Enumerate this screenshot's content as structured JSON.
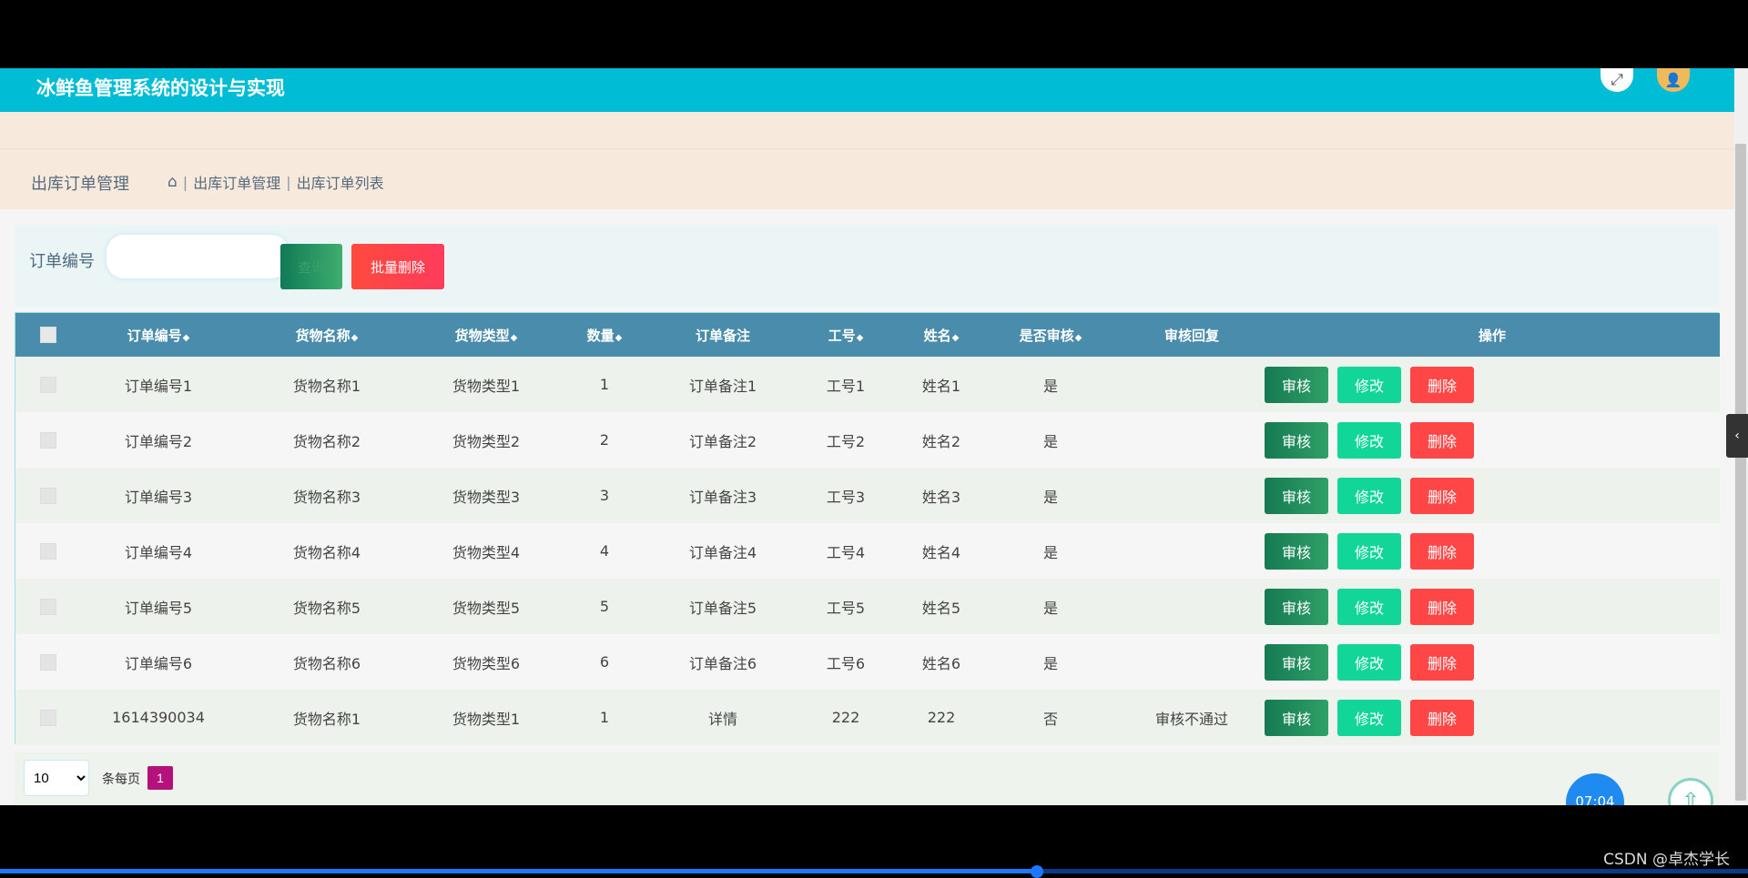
{
  "header": {
    "title": "冰鲜鱼管理系统的设计与实现"
  },
  "page": {
    "section_title": "出库订单管理",
    "breadcrumb": [
      "出库订单管理",
      "出库订单列表"
    ]
  },
  "search": {
    "label": "订单编号",
    "input_value": "",
    "search_label": "查询",
    "batch_delete_label": "批量删除"
  },
  "table": {
    "headers": {
      "order_no": "订单编号",
      "goods_name": "货物名称",
      "goods_type": "货物类型",
      "qty": "数量",
      "remark": "订单备注",
      "emp_no": "工号",
      "name": "姓名",
      "audited": "是否审核",
      "reply": "审核回复",
      "ops": "操作"
    },
    "sort_glyph": "◆",
    "rows": [
      [
        "订单编号1",
        "货物名称1",
        "货物类型1",
        "1",
        "订单备注1",
        "工号1",
        "姓名1",
        "是",
        ""
      ],
      [
        "订单编号2",
        "货物名称2",
        "货物类型2",
        "2",
        "订单备注2",
        "工号2",
        "姓名2",
        "是",
        ""
      ],
      [
        "订单编号3",
        "货物名称3",
        "货物类型3",
        "3",
        "订单备注3",
        "工号3",
        "姓名3",
        "是",
        ""
      ],
      [
        "订单编号4",
        "货物名称4",
        "货物类型4",
        "4",
        "订单备注4",
        "工号4",
        "姓名4",
        "是",
        ""
      ],
      [
        "订单编号5",
        "货物名称5",
        "货物类型5",
        "5",
        "订单备注5",
        "工号5",
        "姓名5",
        "是",
        ""
      ],
      [
        "订单编号6",
        "货物名称6",
        "货物类型6",
        "6",
        "订单备注6",
        "工号6",
        "姓名6",
        "是",
        ""
      ],
      [
        "1614390034",
        "货物名称1",
        "货物类型1",
        "1",
        "详情",
        "222",
        "222",
        "否",
        "审核不通过"
      ]
    ],
    "op_labels": {
      "audit": "审核",
      "edit": "修改",
      "delete": "删除"
    }
  },
  "pager": {
    "page_size": "10",
    "per_page_label": "条每页",
    "current_page": "1"
  },
  "overlay": {
    "clock": "07:04",
    "watermark": "CSDN @卓杰学长"
  },
  "colors": {
    "topbar": "#00bcd4",
    "table_header": "#4a8cab",
    "audit_button": "#157a53",
    "edit_button": "#12d698",
    "delete_button": "#ff4646",
    "page_active": "#b5117c"
  },
  "icons": {
    "expand": "expand-icon",
    "avatar": "user-avatar-icon",
    "home": "home-icon",
    "back_to_top": "arrow-up-icon",
    "side_toggle": "chevron-left-icon"
  }
}
